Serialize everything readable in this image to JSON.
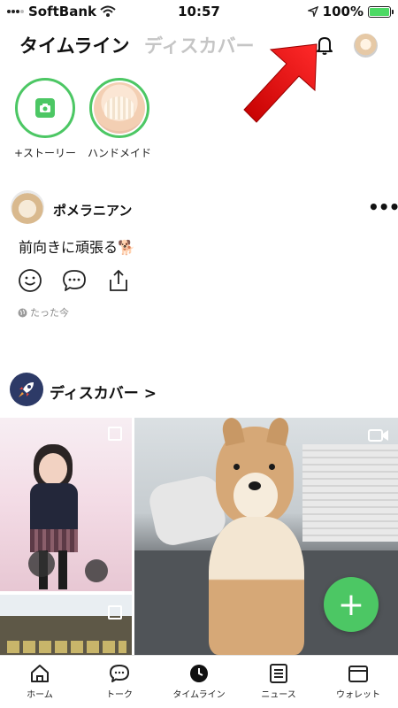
{
  "status_bar": {
    "carrier": "SoftBank",
    "time": "10:57",
    "battery": "100%",
    "battery_level": 1.0
  },
  "header": {
    "tab_active": "タイムライン",
    "tab_inactive": "ディスカバー",
    "icons": [
      "bell-icon",
      "profile-avatar"
    ]
  },
  "stories": [
    {
      "label": "+ストーリー",
      "icon": "camera-icon"
    },
    {
      "label": "ハンドメイド",
      "icon": "knit-hat-thumbnail"
    }
  ],
  "post": {
    "author": "ポメラニアン",
    "text": "前向きに頑張る🐕",
    "time": "たった今",
    "actions": [
      "smile-icon",
      "comment-icon",
      "share-icon"
    ]
  },
  "discover": {
    "title": "ディスカバー >"
  },
  "fab_label": "+",
  "bottom_nav": [
    {
      "label": "ホーム",
      "icon": "home-icon"
    },
    {
      "label": "トーク",
      "icon": "chat-icon"
    },
    {
      "label": "タイムライン",
      "icon": "timeline-clock-icon"
    },
    {
      "label": "ニュース",
      "icon": "news-icon"
    },
    {
      "label": "ウォレット",
      "icon": "wallet-icon"
    }
  ],
  "colors": {
    "accent_green": "#4cc764",
    "annotation_red": "#ff1e1e",
    "inactive_tab": "#c5c5c5"
  }
}
